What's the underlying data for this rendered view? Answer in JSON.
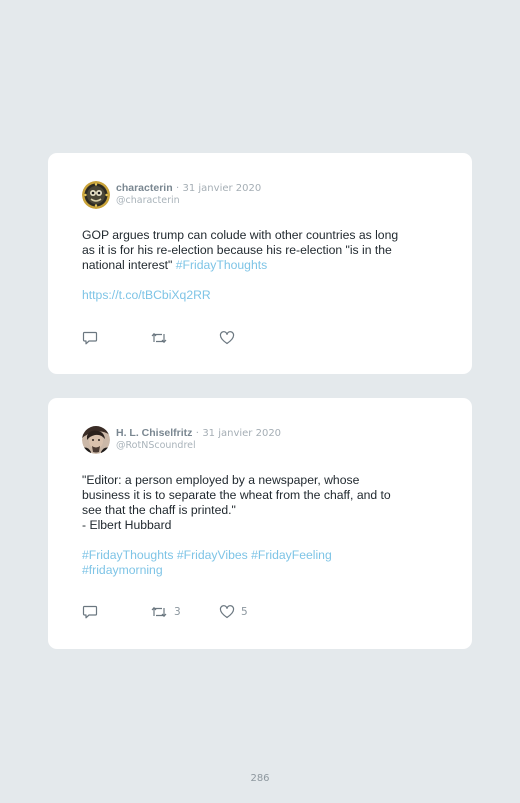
{
  "tweets": [
    {
      "display_name": "characterin",
      "separator": "·",
      "date": "31 janvier 2020",
      "handle": "@characterin",
      "lines": [
        "GOP argues trump can colude with other countries as long",
        "as it is for his re-election because his re-election \"is in the",
        "national interest\""
      ],
      "inline_hashtag": "#FridayThoughts",
      "link": "https://t.co/tBCbiXq2RR",
      "retweet_count": "",
      "like_count": ""
    },
    {
      "display_name": "H. L. Chiselfritz",
      "separator": "·",
      "date": "31 janvier 2020",
      "handle": "@RotNScoundrel",
      "lines": [
        "\"Editor: a person employed by a newspaper, whose",
        "business it is to separate the wheat from the chaff, and to",
        "see that the chaff is printed.\"",
        "- Elbert Hubbard"
      ],
      "hashtag_lines": [
        "#FridayThoughts #FridayVibes #FridayFeeling",
        "#fridaymorning"
      ],
      "retweet_count": "3",
      "like_count": "5"
    }
  ],
  "icons": {
    "reply": "reply-icon",
    "retweet": "retweet-icon",
    "like": "heart-icon"
  },
  "colors": {
    "background": "#e4e9ec",
    "card": "#ffffff",
    "hashtag": "#7ec4e6",
    "name": "#7a8791"
  },
  "page_number": "286"
}
